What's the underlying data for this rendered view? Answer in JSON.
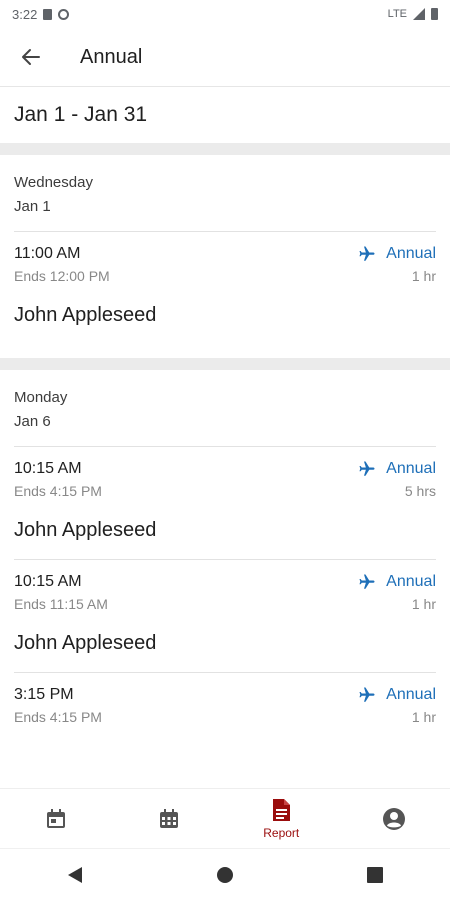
{
  "status_bar": {
    "time": "3:22",
    "network": "LTE"
  },
  "app_bar": {
    "title": "Annual"
  },
  "date_range": "Jan 1 - Jan 31",
  "days": [
    {
      "weekday": "Wednesday",
      "date": "Jan 1",
      "entries": [
        {
          "start": "11:00 AM",
          "ends": "Ends 12:00 PM",
          "type": "Annual",
          "duration": "1 hr",
          "person": "John Appleseed"
        }
      ]
    },
    {
      "weekday": "Monday",
      "date": "Jan 6",
      "entries": [
        {
          "start": "10:15 AM",
          "ends": "Ends 4:15 PM",
          "type": "Annual",
          "duration": "5 hrs",
          "person": "John Appleseed"
        },
        {
          "start": "10:15 AM",
          "ends": "Ends 11:15 AM",
          "type": "Annual",
          "duration": "1 hr",
          "person": "John Appleseed"
        },
        {
          "start": "3:15 PM",
          "ends": "Ends 4:15 PM",
          "type": "Annual",
          "duration": "1 hr"
        }
      ]
    }
  ],
  "bottom_nav": {
    "items": [
      {
        "icon": "calendar-day-icon"
      },
      {
        "icon": "calendar-month-icon"
      },
      {
        "icon": "report-icon",
        "label": "Report",
        "active": true
      },
      {
        "icon": "account-icon"
      }
    ]
  },
  "colors": {
    "accent": "#1e6fb8",
    "active_nav": "#9a0d0d",
    "icon_gray": "#555555"
  }
}
